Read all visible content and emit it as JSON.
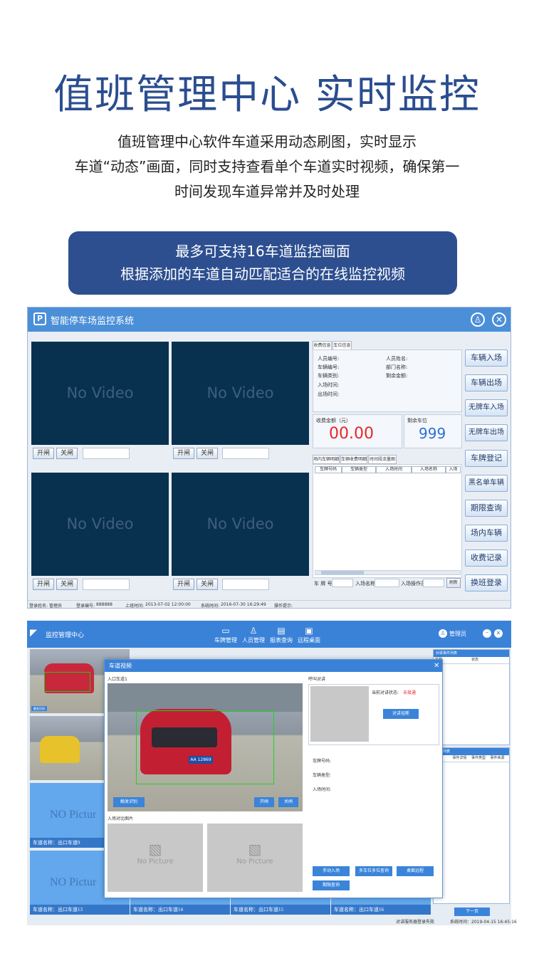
{
  "hero": {
    "title": "值班管理中心 实时监控",
    "desc": [
      "值班管理中心软件车道采用动态刷图，实时显示",
      "车道“动态”画面，同时支持查看单个车道实时视频，确保第一",
      "时间发现车道异常并及时处理"
    ]
  },
  "banner": {
    "lines": [
      "最多可支持16车道监控画面",
      "根据添加的车道自动匹配适合的在线监控视频"
    ]
  },
  "win1": {
    "title": "智能停车场监控系统",
    "logo": "P",
    "no_video": "No Video",
    "open": "开闸",
    "close": "关闸",
    "tabs": [
      "收费信息",
      "车位信息"
    ],
    "info_left": [
      "人员编号:",
      "车辆编号:",
      "车辆类别:",
      "入场时间:",
      "出场时间:"
    ],
    "info_right": [
      "人员姓名:",
      "部门名称:",
      "剩余金额:"
    ],
    "fee_label": "收费金额（元）",
    "fee_value": "00.00",
    "space_label": "剩余车位",
    "space_value": "999",
    "list_tabs": [
      "场内车辆明细",
      "车辆收费明细",
      "时间段流量图"
    ],
    "list_cols": [
      "车牌号码",
      "车辆类型",
      "入场时间",
      "入场名称",
      "入场"
    ],
    "search": {
      "plate": "车 牌 号",
      "name": "入场名称",
      "op": "入场操作员",
      "refresh": "刷新"
    },
    "side_buttons": [
      "车辆入场",
      "车辆出场",
      "无牌车入场",
      "无牌车出场",
      "车牌登记",
      "黑名单车辆",
      "期限查询",
      "场内车辆",
      "收费记录",
      "换班登录"
    ],
    "status": {
      "name": "登录姓名:",
      "name_val": "管理员",
      "id": "登录编号:",
      "id_val": "888888",
      "last": "上班时间:",
      "last_val": "2013-07-02 12:00:00",
      "sys": "系统时间:",
      "sys_val": "2016-07-30 16:29:49",
      "tip": "操作提示:"
    }
  },
  "win2": {
    "title": "监控管理中心",
    "nav": [
      {
        "icon": "▭",
        "label": "车牌管理"
      },
      {
        "icon": "♙",
        "label": "人员管理"
      },
      {
        "icon": "▤",
        "label": "报表查询"
      },
      {
        "icon": "▣",
        "label": "远程桌面"
      }
    ],
    "user": "管理员",
    "no_picture_lane": "NO Pictur",
    "lanes": [
      "车道名称：出口车道9",
      "车道名称：出口车道13",
      "车道名称：出口车道14",
      "车道名称：出口车道15",
      "车道名称：出口车道16"
    ],
    "plate": "AA 12869",
    "dialog": {
      "title": "车道视频",
      "lane": "入口车道1",
      "trigger": "触发识别",
      "open": "开闸",
      "close": "关闸",
      "compare": "入场对比图片",
      "no_picture": "No Picture",
      "intercom": "呼叫对讲",
      "state_label": "当前对讲状态:",
      "state_val": "未接通",
      "hangup": "对讲挂断",
      "fields": [
        "车牌号码:",
        "车辆类型:",
        "入场时间:"
      ],
      "buttons": [
        "手动入场",
        "多车位多位查询",
        "桌面远程",
        "期限查询"
      ]
    },
    "right": {
      "events": "对讲事件列表",
      "events_cols": [
        "名称",
        "状态"
      ],
      "status": "状态列表",
      "status_cols": [
        "名称",
        "事件详情",
        "事件类型",
        "事件来源"
      ],
      "next": "下一页"
    },
    "footer": {
      "fail": "对讲服务器登录失败",
      "sys": "系统时间：2019-04-15 16:45:16"
    },
    "small_btn": "触发识别"
  }
}
